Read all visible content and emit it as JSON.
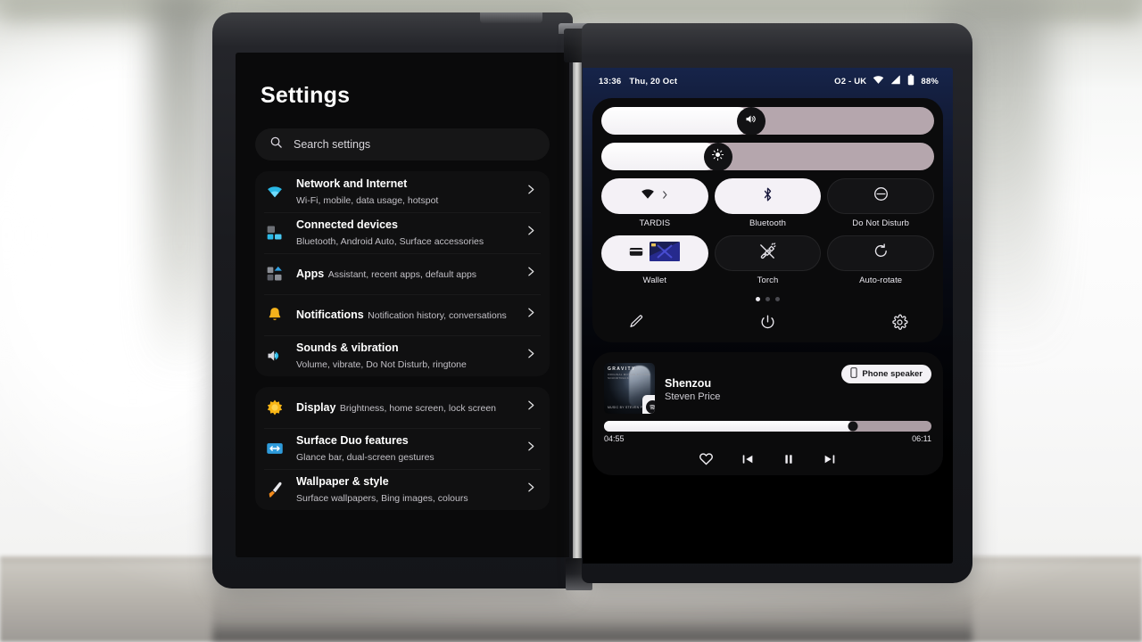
{
  "device": {
    "name": "Surface Duo 2 dual-screen device"
  },
  "left_screen": {
    "title": "Settings",
    "search": {
      "placeholder": "Search settings",
      "icon": "search-icon"
    },
    "groups": [
      {
        "items": [
          {
            "icon": "wifi-icon",
            "title": "Network and Internet",
            "subtitle": "Wi-Fi, mobile, data usage, hotspot"
          },
          {
            "icon": "devices-icon",
            "title": "Connected devices",
            "subtitle": "Bluetooth, Android Auto, Surface accessories"
          },
          {
            "icon": "apps-icon",
            "title": "Apps",
            "subtitle": "Assistant, recent apps, default apps"
          },
          {
            "icon": "bell-icon",
            "title": "Notifications",
            "subtitle": "Notification history, conversations"
          },
          {
            "icon": "speaker-icon",
            "title": "Sounds & vibration",
            "subtitle": "Volume, vibrate, Do Not Disturb, ringtone"
          }
        ]
      },
      {
        "items": [
          {
            "icon": "brightness-icon",
            "title": "Display",
            "subtitle": "Brightness, home screen, lock screen"
          },
          {
            "icon": "dual-screen-icon",
            "title": "Surface Duo features",
            "subtitle": "Glance bar, dual-screen gestures"
          },
          {
            "icon": "brush-icon",
            "title": "Wallpaper & style",
            "subtitle": "Surface wallpapers, Bing images, colours"
          }
        ]
      }
    ]
  },
  "right_screen": {
    "status_bar": {
      "time": "13:36",
      "date": "Thu, 20 Oct",
      "carrier": "O2 - UK",
      "battery_percent": "88%",
      "icons": [
        "wifi-icon",
        "signal-icon",
        "battery-icon"
      ]
    },
    "sliders": [
      {
        "name": "volume",
        "icon": "volume-icon",
        "value": 45
      },
      {
        "name": "brightness",
        "icon": "brightness-icon",
        "value": 35
      }
    ],
    "tiles": [
      {
        "label": "TARDIS",
        "icon": "wifi-icon",
        "state": "on",
        "expandable": true
      },
      {
        "label": "Bluetooth",
        "icon": "bluetooth-icon",
        "state": "on",
        "expandable": false
      },
      {
        "label": "Do Not Disturb",
        "icon": "dnd-icon",
        "state": "off",
        "expandable": false
      },
      {
        "label": "Wallet",
        "icon": "wallet-icon",
        "state": "on",
        "expandable": false
      },
      {
        "label": "Torch",
        "icon": "torch-off-icon",
        "state": "off",
        "expandable": false
      },
      {
        "label": "Auto-rotate",
        "icon": "autorotate-icon",
        "state": "off",
        "expandable": false
      }
    ],
    "pages": {
      "count": 3,
      "active": 1
    },
    "actions": [
      {
        "name": "edit-tiles",
        "icon": "pencil-icon"
      },
      {
        "name": "power-menu",
        "icon": "power-icon"
      },
      {
        "name": "open-settings",
        "icon": "gear-icon"
      }
    ],
    "media": {
      "track_title": "Shenzou",
      "artist": "Steven Price",
      "album_art": {
        "title": "GRAVITY",
        "subtitle": "ORIGINAL MOTION PICTURE SOUNDTRACK",
        "footer": "MUSIC BY STEVEN PRICE",
        "app_icon": "spotify-icon"
      },
      "output_chip": {
        "label": "Phone speaker",
        "icon": "phone-icon"
      },
      "elapsed": "04:55",
      "duration": "06:11",
      "progress_percent": 76,
      "controls": [
        {
          "name": "favourite",
          "icon": "heart-icon"
        },
        {
          "name": "previous",
          "icon": "previous-icon"
        },
        {
          "name": "pause",
          "icon": "pause-icon"
        },
        {
          "name": "next",
          "icon": "next-icon"
        }
      ]
    }
  },
  "colors": {
    "accent_wifi": "#2ab8e6",
    "accent_bell": "#f5b21b",
    "accent_display": "#f8b515",
    "accent_duo": "#2e9bdb",
    "panel_bg": "#0b0b0c",
    "tile_on": "#f4f1f6",
    "tile_off": "#141416"
  }
}
